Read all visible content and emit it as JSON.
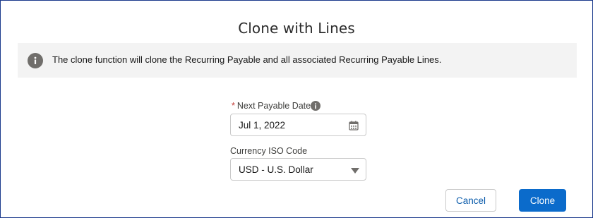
{
  "dialog": {
    "title": "Clone with Lines",
    "info_message": "The clone function will clone the Recurring Payable and all associated Recurring Payable Lines.",
    "icons": {
      "info": "info-circle-icon",
      "help": "info-help-icon",
      "calendar": "calendar-icon",
      "dropdown": "chevron-down-icon"
    }
  },
  "form": {
    "next_payable_date": {
      "required_marker": "*",
      "label": "Next Payable Date",
      "value": "Jul 1, 2022"
    },
    "currency_iso_code": {
      "label": "Currency ISO Code",
      "selected": "USD - U.S. Dollar"
    }
  },
  "actions": {
    "cancel_label": "Cancel",
    "clone_label": "Clone"
  },
  "colors": {
    "brand_blue": "#0b6bcb",
    "link_blue": "#0b5cab",
    "required_red": "#c23934",
    "banner_bg": "#f3f3f3",
    "icon_gray": "#706e6b"
  }
}
